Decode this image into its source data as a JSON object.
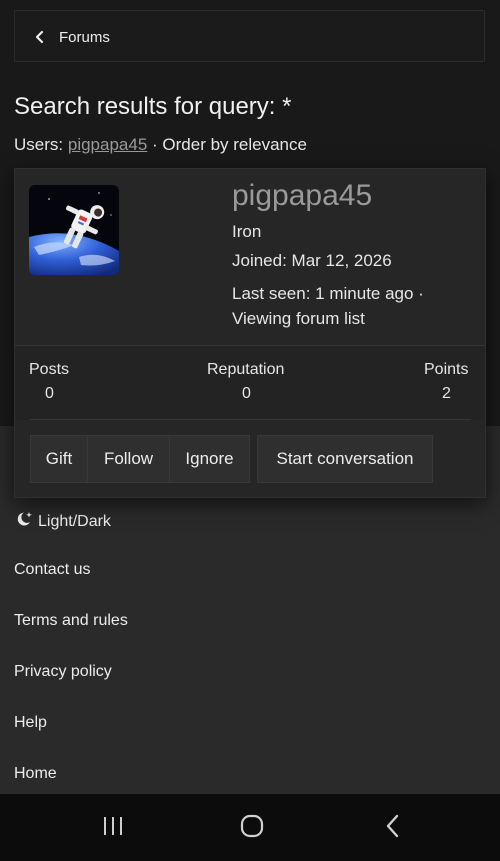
{
  "header": {
    "back_label": "Forums"
  },
  "search": {
    "title": "Search results for query: *",
    "users_prefix": "Users:",
    "user_link": "pigpapa45",
    "order_text": "· Order by relevance"
  },
  "member_card": {
    "username": "pigpapa45",
    "rank": "Iron",
    "joined": "Joined: Mar 12, 2026",
    "last_seen_line1": "Last seen: 1 minute ago ·",
    "last_seen_line2": "Viewing forum list",
    "stats": [
      {
        "label": "Posts",
        "value": "0"
      },
      {
        "label": "Reputation",
        "value": "0"
      },
      {
        "label": "Points",
        "value": "2"
      }
    ],
    "actions": {
      "gift": "Gift",
      "follow": "Follow",
      "ignore": "Ignore",
      "start_conversation": "Start conversation"
    }
  },
  "footer": {
    "light_dark": "Light/Dark",
    "contact": "Contact us",
    "terms": "Terms and rules",
    "privacy": "Privacy policy",
    "help": "Help",
    "home": "Home"
  },
  "icons": {
    "back": "chevron-left-icon",
    "theme": "moon-icon",
    "recent_apps": "recent-apps-icon",
    "home_nav": "home-circle-icon",
    "back_nav": "back-arrow-icon"
  }
}
